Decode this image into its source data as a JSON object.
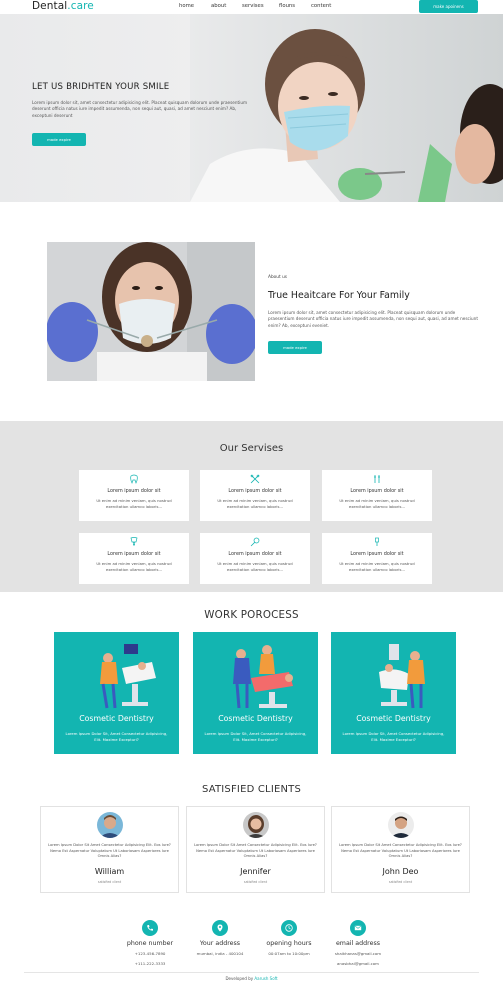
{
  "brand": {
    "name_a": "Dental",
    "name_b": ".care",
    "accent": "#13b5b1"
  },
  "nav": {
    "items": [
      "home",
      "about",
      "servises",
      "flouns",
      "content"
    ],
    "cta": "make apoinens"
  },
  "hero": {
    "title": "LET US BRIDHTEN YOUR SMILE",
    "text": "Lorem ipsum dolor sit, amet consectetur adipisicing elit. Placeat quisquam dolorum unde praesentium deserunt officia natus iure impedit assumenda, non sequi aut, quasi, ad amet nesciunt enim? Ab, exceptuni deserunt",
    "button": "made expire"
  },
  "about": {
    "small": "About us",
    "title": "True Heaitcare For Your Family",
    "text": "Lorem ipsum dolor sit, amet consectetur adipisicing elit. Placeat quisquam dolorum unde praesentium deserunt officia natus iure impedit assumenda, non sequi aut, quasi, ad amet nesciunt enim? Ab, exceptuni eveniet.",
    "button": "made expire"
  },
  "services": {
    "title": "Our Servises",
    "items": [
      {
        "icon": "tooth-icon",
        "title": "Lorem ipsum dolor sit",
        "text": "Ut enim ad minim veniam, quis nostrud exercitation ullamco laboris..."
      },
      {
        "icon": "dental-tools-icon",
        "title": "Lorem ipsum dolor sit",
        "text": "Ut enim ad minim veniam, quis nostrud exercitation ullamco laboris..."
      },
      {
        "icon": "dental-instruments-icon",
        "title": "Lorem ipsum dolor sit",
        "text": "Ut enim ad minim veniam, quis nostrud exercitation ullamco laboris..."
      },
      {
        "icon": "tooth-implant-icon",
        "title": "Lorem ipsum dolor sit",
        "text": "Ut enim ad minim veniam, quis nostrud exercitation ullamco laboris..."
      },
      {
        "icon": "mouth-mirror-icon",
        "title": "Lorem ipsum dolor sit",
        "text": "Ut enim ad minim veniam, quis nostrud exercitation ullamco laboris..."
      },
      {
        "icon": "tooth-brush-icon",
        "title": "Lorem ipsum dolor sit",
        "text": "Ut enim ad minim veniam, quis nostrud exercitation ullamco laboris..."
      }
    ]
  },
  "work": {
    "title": "WORK POROCESS",
    "items": [
      {
        "title": "Cosmetic Dentistry",
        "text": "Lorem Ipsum Dolor Sit, Amet Consectetur Adipisicing, Elit. Maxime Excepturi?"
      },
      {
        "title": "Cosmetic Dentistry",
        "text": "Lorem Ipsum Dolor Sit, Amet Consectetur Adipisicing, Elit. Maxime Excepturi?"
      },
      {
        "title": "Cosmetic Dentistry",
        "text": "Lorem Ipsum Dolor Sit, Amet Consectetur Adipisicing, Elit. Maxime Excepturi?"
      }
    ]
  },
  "clients": {
    "title": "SATISFIED CLIENTS",
    "items": [
      {
        "quote": "Lorem Ipsum Dolor Sit Amet Consectetur Adipisicing Elit. Eos Iure? Nemo Est Aspernatur Voluptatum Ut Laboriosam Asperiores Iure Omnis Alias?",
        "name": "William",
        "role": "satisfied client"
      },
      {
        "quote": "Lorem Ipsum Dolor Sit Amet Consectetur Adipisicing Elit. Eos Iure? Nemo Est Aspernatur Voluptatum Ut Laboriosam Asperiores Iure Omnis Alias?",
        "name": "Jennifer",
        "role": "satisfied client"
      },
      {
        "quote": "Lorem Ipsum Dolor Sit Amet Consectetur Adipisicing Elit. Eos Iure? Nemo Est Aspernatur Voluptatum Ut Laboriosam Asperiores Iure Omnis Alias?",
        "name": "John Deo",
        "role": "satisfied client"
      }
    ]
  },
  "contact": {
    "items": [
      {
        "icon": "phone-icon",
        "title": "phone number",
        "line1": "+123-456-7890",
        "line2": "+111-222-3333"
      },
      {
        "icon": "location-pin-icon",
        "title": "Your address",
        "line1": "mumbai, india - 400104",
        "line2": ""
      },
      {
        "icon": "clock-icon",
        "title": "opening hours",
        "line1": "00:07am to 10:00pm",
        "line2": ""
      },
      {
        "icon": "mail-icon",
        "title": "email address",
        "line1": "shaikhanas@gmail.com",
        "line2": "anasbhai@gmail.com"
      }
    ]
  },
  "footer": {
    "prefix": "Developed by",
    "author": "Aarush Soft"
  }
}
